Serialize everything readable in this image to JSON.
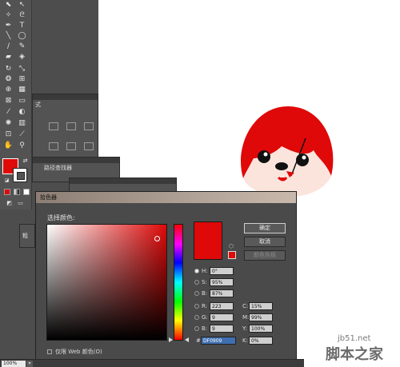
{
  "status": {
    "zoom": "100%"
  },
  "toolbar": {
    "fill_color": "#df0909"
  },
  "panels": {
    "pathfinder_tab": "路径查找器",
    "format_label": "式",
    "partial_label": "粗"
  },
  "dialog": {
    "title": "拾色器",
    "select_color_label": "选择颜色:",
    "current_color": "#df0909",
    "buttons": {
      "ok": "确定",
      "cancel": "取消",
      "swatches": "颜色色板"
    },
    "hsb": {
      "h_label": "H:",
      "h_value": "0°",
      "s_label": "S:",
      "s_value": "95%",
      "b_label": "B:",
      "b_value": "87%"
    },
    "rgb": {
      "r_label": "R:",
      "r_value": "223",
      "g_label": "G:",
      "g_value": "9",
      "b_label": "B:",
      "b_value": "9"
    },
    "cmyk": {
      "c_label": "C:",
      "c_value": "15%",
      "m_label": "M:",
      "m_value": "99%",
      "y_label": "Y:",
      "y_value": "100%",
      "k_label": "K:",
      "k_value": "0%"
    },
    "hex_label": "#",
    "hex_value": "DF0909",
    "web_only_label": "仅限 Web 颜色(O)"
  },
  "watermark": {
    "url": "jb51.net",
    "logo": "脚本之家"
  }
}
